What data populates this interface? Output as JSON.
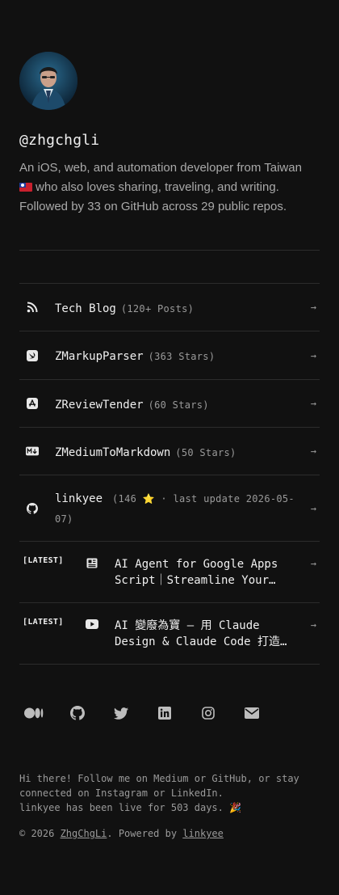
{
  "profile": {
    "handle": "@zhgchgli",
    "bio_line1": "An iOS, web, and automation developer from Taiwan",
    "bio_line2": "who also loves sharing, traveling, and writing.",
    "bio_line3": "Followed by 33 on GitHub across 29 public repos."
  },
  "links": [
    {
      "icon": "rss-icon",
      "name": "Tech Blog",
      "meta": "(120+ Posts)",
      "arrow": "→"
    },
    {
      "icon": "swift-icon",
      "name": "ZMarkupParser",
      "meta": "(363 Stars)",
      "arrow": "→"
    },
    {
      "icon": "app-store-icon",
      "name": "ZReviewTender",
      "meta": "(60 Stars)",
      "arrow": "→"
    },
    {
      "icon": "markdown-icon",
      "name": "ZMediumToMarkdown",
      "meta": "(50 Stars)",
      "arrow": "→"
    },
    {
      "icon": "github-icon",
      "name": "linkyee",
      "meta_line1": "(146 ⭐ · last update 2026-05-",
      "meta_line2": "07)",
      "arrow": "→"
    }
  ],
  "latest": [
    {
      "tag": "[LATEST]",
      "icon": "newspaper-icon",
      "line1": "AI Agent for Google Apps",
      "line2": "Script｜Streamline Your…",
      "arrow": "→"
    },
    {
      "tag": "[LATEST]",
      "icon": "youtube-icon",
      "line1": "AI 變廢為寶 — 用 Claude",
      "line2": "Design & Claude Code 打造…",
      "arrow": "→"
    }
  ],
  "social_icons": [
    "medium-icon",
    "github-icon",
    "twitter-icon",
    "linkedin-icon",
    "instagram-icon",
    "email-icon"
  ],
  "footer": {
    "line1": "Hi there! Follow me on Medium or GitHub, or stay",
    "line2": "connected on Instagram or LinkedIn.",
    "line3": "linkyee has been live for 503 days. 🎉",
    "copy_prefix": "© 2026 ",
    "copy_owner": "ZhgChgLi",
    "copy_mid": ". Powered by ",
    "copy_powered": "linkyee"
  },
  "colors": {
    "background": "#111111",
    "text": "#f0f0f0",
    "muted": "#9a9a9a",
    "divider": "#2c2c2c"
  }
}
